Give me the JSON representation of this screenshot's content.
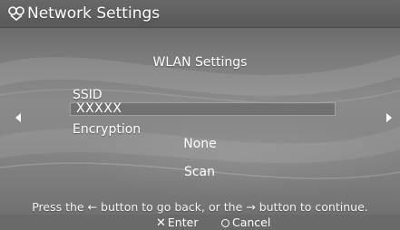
{
  "header_bar": {
    "title": "Network Settings",
    "icon": "network-settings-icon"
  },
  "content": {
    "heading": "WLAN Settings",
    "ssid_label": "SSID",
    "ssid_value": "XXXXX",
    "encryption_label": "Encryption",
    "encryption_value": "None",
    "scan_label": "Scan"
  },
  "hint": {
    "prefix": "Press the ",
    "back_arrow": "←",
    "middle": " button to go back, or the ",
    "forward_arrow": "→",
    "suffix": " button to continue."
  },
  "footer": {
    "enter_symbol": "✕",
    "enter_label": "Enter",
    "cancel_label": "Cancel"
  },
  "colors": {
    "text": "#ffffff",
    "background": "#7a7a7a",
    "bar": "#5e5e5e"
  }
}
